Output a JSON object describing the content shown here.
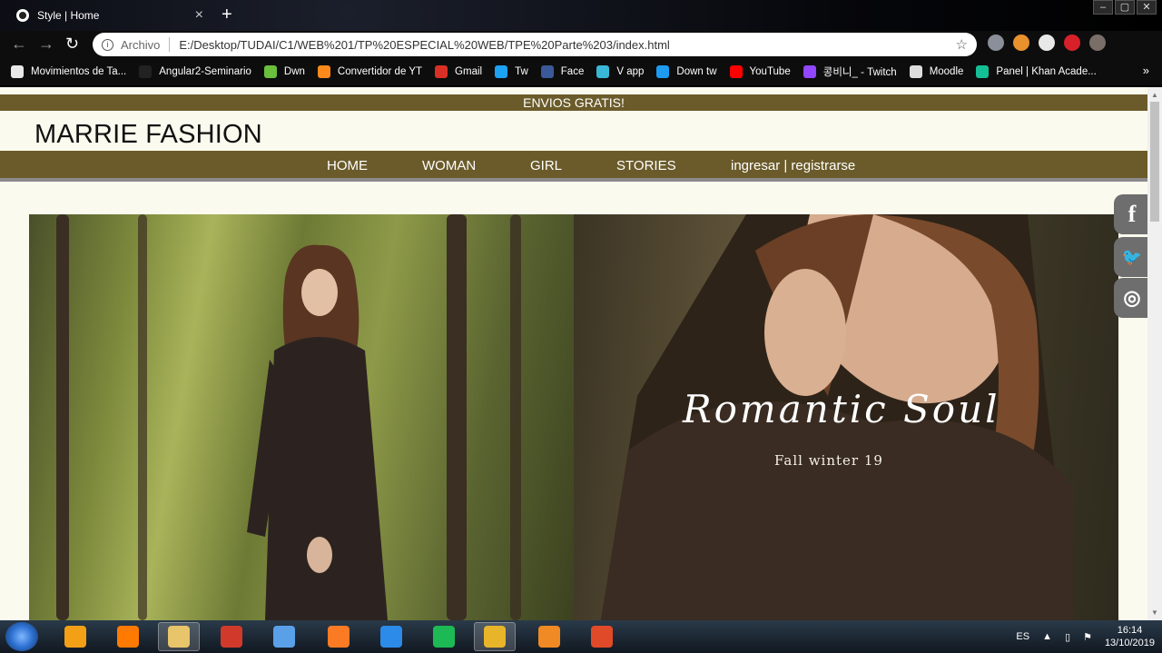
{
  "browser": {
    "tab_title": "Style | Home",
    "tab_close": "×",
    "new_tab": "+",
    "url_prefix": "Archivo",
    "url": "E:/Desktop/TUDAI/C1/WEB%201/TP%20ESPECIAL%20WEB/TPE%20Parte%203/index.html",
    "window_buttons": [
      "–",
      "▢",
      "✕"
    ],
    "nav": {
      "back": "←",
      "forward": "→",
      "reload": "↻"
    },
    "star": "☆",
    "extensions": [
      {
        "name": "shield-extension-icon",
        "color": "#8a8f99"
      },
      {
        "name": "key-extension-icon",
        "color": "#e8912d"
      },
      {
        "name": "white-circle-extension-icon",
        "color": "#e8e8e8"
      },
      {
        "name": "adblock-extension-icon",
        "color": "#d8202a"
      },
      {
        "name": "profile-avatar-icon",
        "color": "#7a6f68"
      }
    ],
    "bookmarks": [
      {
        "label": "Movimientos de Ta...",
        "icon": "globe-icon",
        "color": "#e8e8e8"
      },
      {
        "label": "Angular2-Seminario",
        "icon": "github-icon",
        "color": "#222222"
      },
      {
        "label": "Dwn",
        "icon": "download-icon",
        "color": "#6abf3c"
      },
      {
        "label": "Convertidor de YT",
        "icon": "converter-icon",
        "color": "#ff8a1c"
      },
      {
        "label": "Gmail",
        "icon": "gmail-icon",
        "color": "#d93025"
      },
      {
        "label": "Tw",
        "icon": "twitter-icon",
        "color": "#1da1f2"
      },
      {
        "label": "Face",
        "icon": "facebook-icon",
        "color": "#3b5998"
      },
      {
        "label": "V app",
        "icon": "vapp-icon",
        "color": "#39b7d6"
      },
      {
        "label": "Down tw",
        "icon": "downtw-icon",
        "color": "#1d9bf0"
      },
      {
        "label": "YouTube",
        "icon": "youtube-icon",
        "color": "#ff0000"
      },
      {
        "label": "콩비니_ - Twitch",
        "icon": "twitch-icon",
        "color": "#9146ff"
      },
      {
        "label": "Moodle",
        "icon": "moodle-icon",
        "color": "#dddddd"
      },
      {
        "label": "Panel | Khan Acade...",
        "icon": "khan-icon",
        "color": "#14bf96"
      }
    ],
    "bookmarks_more": "»"
  },
  "site": {
    "promo": "ENVIOS GRATIS!",
    "brand": "MARRIE FASHION",
    "nav": [
      "HOME",
      "WOMAN",
      "GIRL",
      "STORIES",
      "ingresar | registrarse"
    ],
    "hero_title": "Romantic Soul",
    "hero_subtitle": "Fall winter 19",
    "social": [
      {
        "label": "f",
        "icon": "facebook-icon"
      },
      {
        "label": "🐦",
        "icon": "twitter-icon"
      },
      {
        "label": "◎",
        "icon": "instagram-icon"
      }
    ]
  },
  "taskbar": {
    "apps": [
      {
        "name": "taskbar-app-ccleaner",
        "color": "#f4a017",
        "active": false
      },
      {
        "name": "taskbar-app-avast",
        "color": "#ff7a00",
        "active": false
      },
      {
        "name": "taskbar-app-explorer",
        "color": "#e8c46a",
        "active": true
      },
      {
        "name": "taskbar-app-ccleaner-red",
        "color": "#d13a2b",
        "active": false
      },
      {
        "name": "taskbar-app-launcher",
        "color": "#5aa0e8",
        "active": false
      },
      {
        "name": "taskbar-app-xampp",
        "color": "#fb7a24",
        "active": false
      },
      {
        "name": "taskbar-app-vscode",
        "color": "#2c8ae8",
        "active": false
      },
      {
        "name": "taskbar-app-spotify",
        "color": "#1db954",
        "active": false
      },
      {
        "name": "taskbar-app-chrome",
        "color": "#e8b52a",
        "active": true
      },
      {
        "name": "taskbar-app-blender",
        "color": "#f08a24",
        "active": false
      },
      {
        "name": "taskbar-app-pdf",
        "color": "#e04a28",
        "active": false
      }
    ],
    "language": "ES",
    "time": "16:14",
    "date": "13/10/2019"
  }
}
